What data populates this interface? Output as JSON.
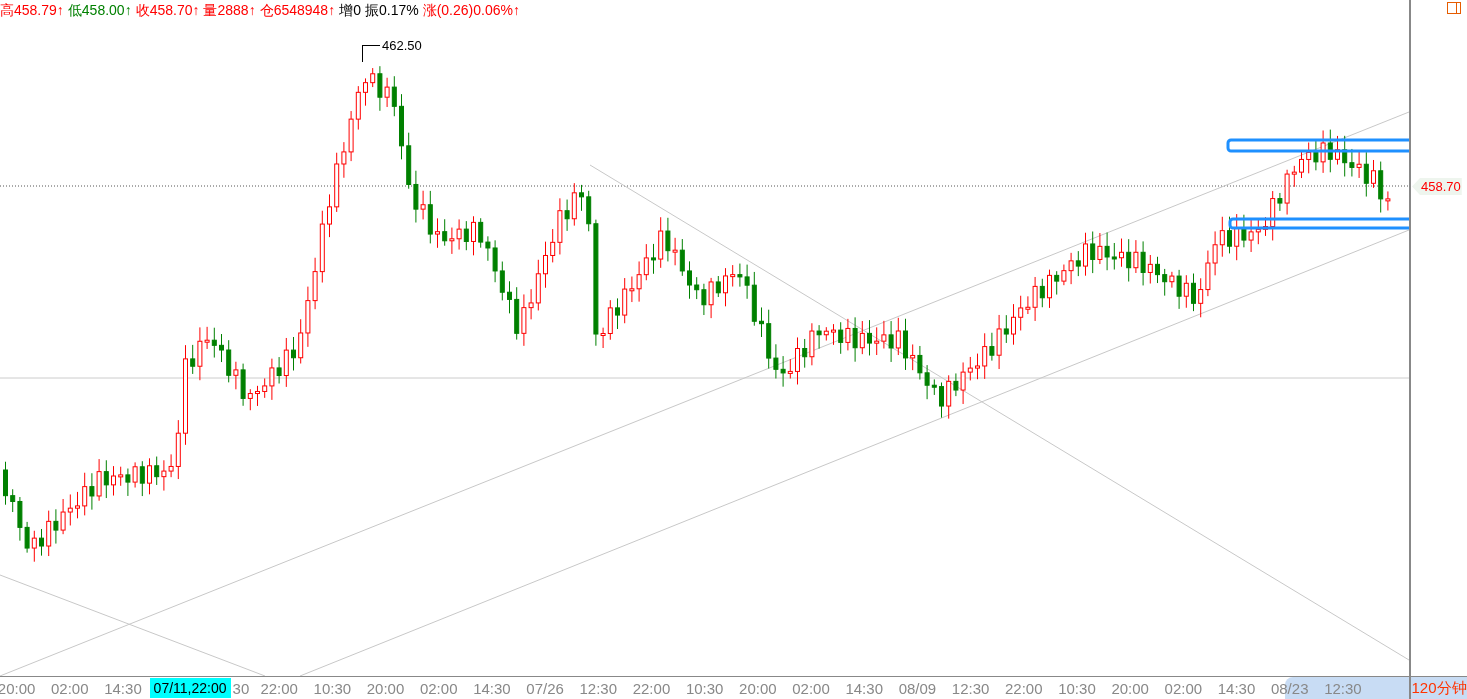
{
  "quote_bar": [
    {
      "text": "高458.79↑",
      "color": "#ff0000"
    },
    {
      "text": "低458.00↑",
      "color": "#008000"
    },
    {
      "text": "收458.70↑",
      "color": "#ff0000"
    },
    {
      "text": "量2888↑",
      "color": "#ff0000"
    },
    {
      "text": "仓6548948↑",
      "color": "#ff0000"
    },
    {
      "text": "增0",
      "color": "#000000"
    },
    {
      "text": "振0.17%",
      "color": "#000000"
    },
    {
      "text": "涨(0.26)0.06%↑",
      "color": "#ff0000"
    }
  ],
  "chart": {
    "peak_label": "462.50",
    "last_price": "458.70"
  },
  "time_axis": {
    "selection_band": true,
    "labels": [
      {
        "text": "20:00",
        "kind": "tick"
      },
      {
        "text": "02:00",
        "kind": "tick"
      },
      {
        "text": "14:30",
        "kind": "tick"
      },
      {
        "text": "07/11,22:00",
        "kind": "cursor"
      },
      {
        "text": "30",
        "kind": "partial"
      },
      {
        "text": "22:00",
        "kind": "tick"
      },
      {
        "text": "10:30",
        "kind": "tick"
      },
      {
        "text": "20:00",
        "kind": "tick"
      },
      {
        "text": "02:00",
        "kind": "tick"
      },
      {
        "text": "14:30",
        "kind": "tick"
      },
      {
        "text": "07/26",
        "kind": "tick"
      },
      {
        "text": "12:30",
        "kind": "tick"
      },
      {
        "text": "22:00",
        "kind": "tick"
      },
      {
        "text": "10:30",
        "kind": "tick"
      },
      {
        "text": "20:00",
        "kind": "tick"
      },
      {
        "text": "02:00",
        "kind": "tick"
      },
      {
        "text": "14:30",
        "kind": "tick"
      },
      {
        "text": "08/09",
        "kind": "tick"
      },
      {
        "text": "12:30",
        "kind": "tick"
      },
      {
        "text": "22:00",
        "kind": "tick"
      },
      {
        "text": "10:30",
        "kind": "tick"
      },
      {
        "text": "20:00",
        "kind": "tick"
      },
      {
        "text": "02:00",
        "kind": "tick"
      },
      {
        "text": "14:30",
        "kind": "tick"
      },
      {
        "text": "08/23",
        "kind": "tick"
      },
      {
        "text": "12:30",
        "kind": "tick"
      }
    ],
    "period": "120分钟"
  }
}
